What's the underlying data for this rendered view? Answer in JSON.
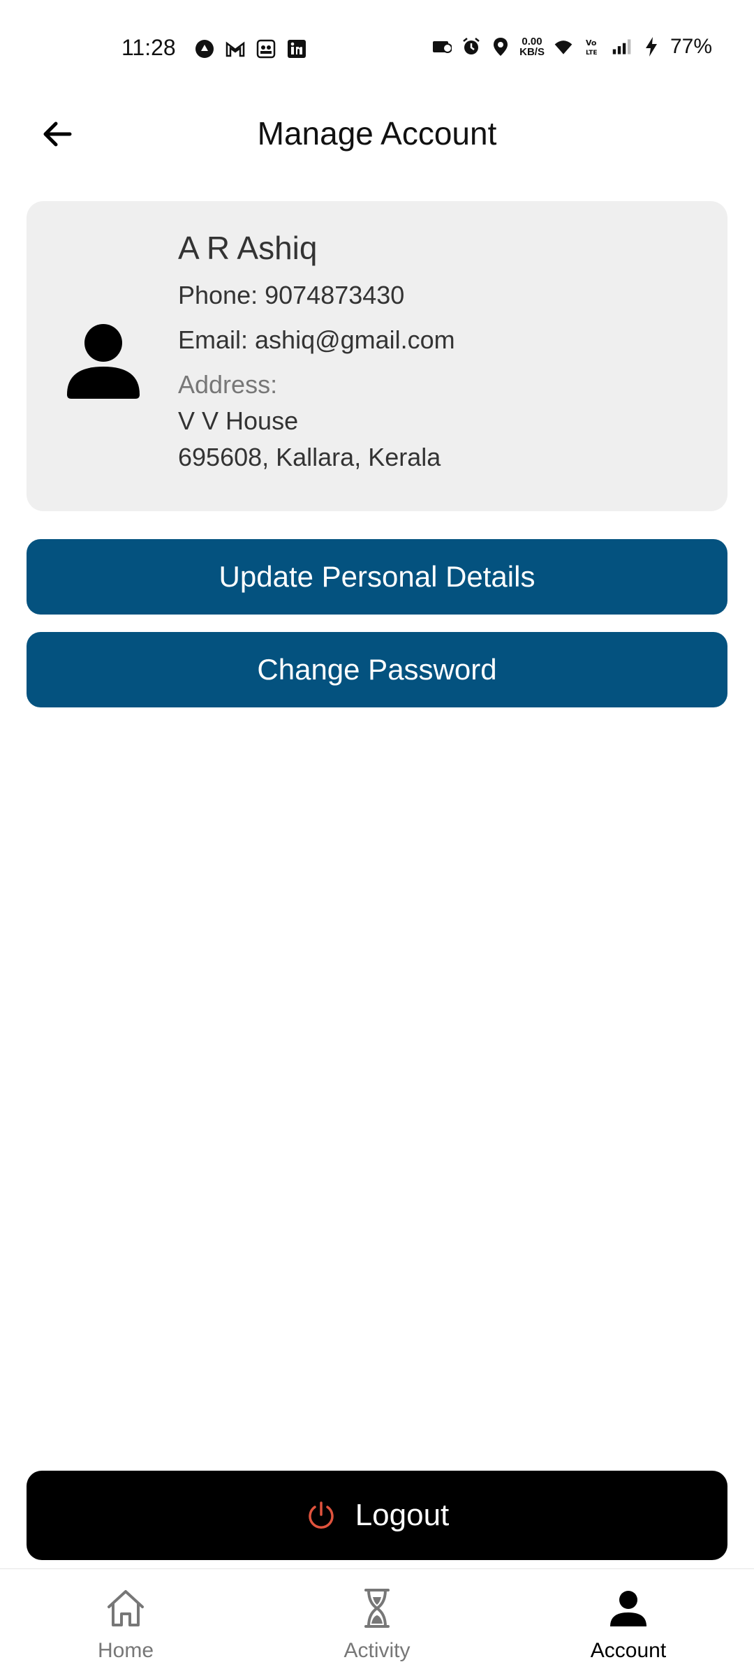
{
  "status_bar": {
    "time": "11:28",
    "netspeed_value": "0.00",
    "netspeed_unit": "KB/S",
    "battery": "77%"
  },
  "header": {
    "title": "Manage Account"
  },
  "profile": {
    "name": "A R Ashiq",
    "phone": "Phone: 9074873430",
    "email": "Email: ashiq@gmail.com",
    "address_label": "Address:",
    "address_line1": "V V House",
    "address_line2": "695608, Kallara, Kerala"
  },
  "actions": {
    "update_label": "Update Personal Details",
    "password_label": "Change Password",
    "logout_label": "Logout"
  },
  "bottom_nav": {
    "items": [
      {
        "label": "Home",
        "icon": "home-icon"
      },
      {
        "label": "Activity",
        "icon": "hourglass-icon"
      },
      {
        "label": "Account",
        "icon": "person-icon"
      }
    ],
    "active": "Account"
  },
  "colors": {
    "primary": "#04527f",
    "logout_bg": "#000000",
    "power_icon": "#e0533d",
    "card_bg": "#efefef"
  }
}
